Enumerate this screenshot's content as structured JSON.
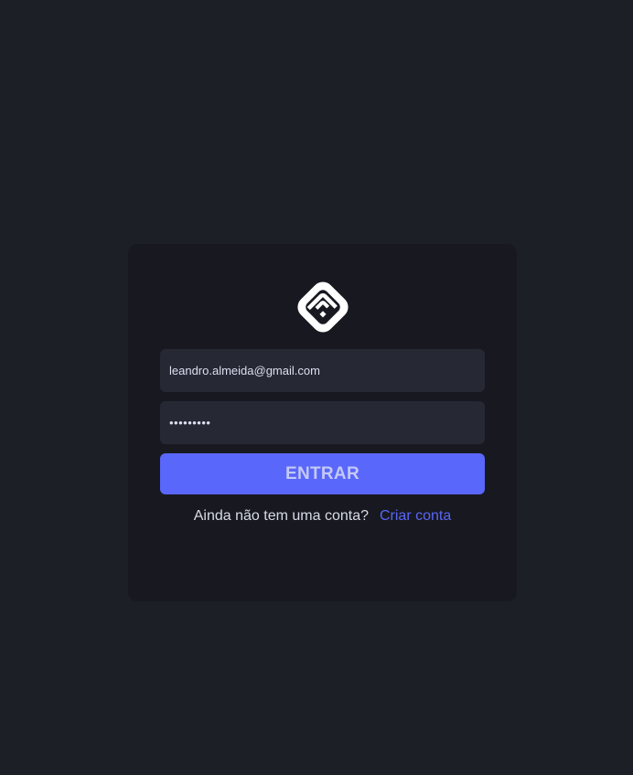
{
  "login_form": {
    "logo_icon": "brand-logo-icon",
    "email_value": "leandro.almeida@gmail.com",
    "password_value": "•••••••••",
    "submit_label": "ENTRAR",
    "signup_prompt": "Ainda não tem uma conta?",
    "signup_link": "Criar conta"
  },
  "colors": {
    "page_background": "#1d1f27",
    "card_background": "#181920",
    "input_background": "#262934",
    "accent": "#5a67fb",
    "link": "#5966f5"
  }
}
